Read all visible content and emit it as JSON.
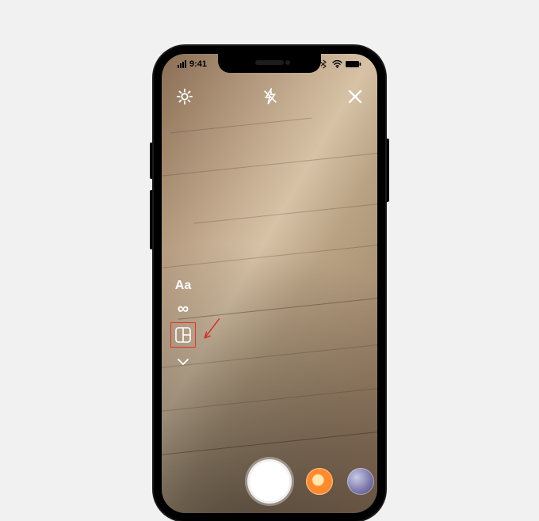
{
  "status": {
    "time": "9:41",
    "signal_bars": 4
  },
  "topbar": {
    "settings_icon": "settings",
    "flash_icon": "flash-off",
    "close_icon": "close"
  },
  "sidetools": {
    "text_label": "Aa",
    "boomerang_label": "∞"
  },
  "annotation": {
    "highlighted_tool": "layout"
  }
}
